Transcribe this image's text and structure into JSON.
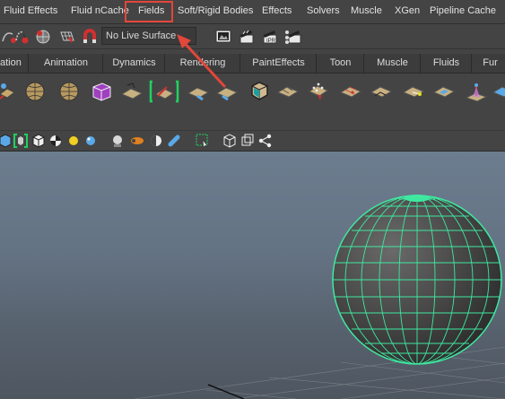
{
  "menubar": {
    "items": [
      "Fluid Effects",
      "Fluid nCache",
      "Fields",
      "Soft/Rigid Bodies",
      "Effects",
      "Solvers",
      "Muscle",
      "XGen",
      "Pipeline Cache"
    ],
    "highlighted": "Fields"
  },
  "statusline": {
    "live_surface": "No Live Surface"
  },
  "shelf": {
    "tabs": [
      "ation",
      "Animation",
      "Dynamics",
      "Rendering",
      "PaintEffects",
      "Toon",
      "Muscle",
      "Fluids",
      "Fur"
    ],
    "icons": [
      "dynamics-tool-icon",
      "particle-sphere-icon",
      "particle-sphere-icon",
      "fluid-container-icon",
      "emitter-plane-icon",
      "field-select-icon",
      "plane-tool-icon",
      "cube-drop-icon",
      "plane-tool-icon",
      "plane-tool-icon",
      "particle-grid-icon",
      "plane-tool-icon",
      "plane-tool-icon",
      "plane-select-icon",
      "plane-tool-icon",
      "fountain-icon",
      "plane-tool-icon"
    ]
  },
  "panel_toolbar": {
    "icons": [
      "cube-icon",
      "bracket-select-icon",
      "cube-icon",
      "checker-icon",
      "sphere-light-icon",
      "sphere-icon",
      "sphere-grey-icon",
      "capsule-icon",
      "half-sphere-icon",
      "pill-icon",
      "select-rect-icon",
      "cube-wire-icon",
      "cube-wire-icon",
      "share-icon"
    ]
  },
  "viewport": {
    "object": "poly-sphere",
    "wire_color": "#3fe8a0"
  },
  "annotation": {
    "color": "#e3463a"
  }
}
